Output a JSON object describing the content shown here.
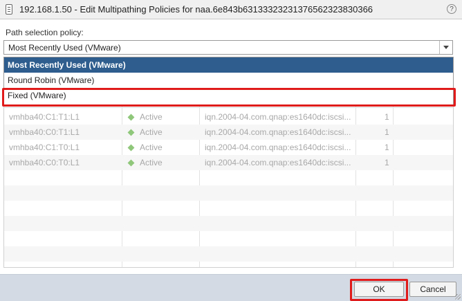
{
  "dialog": {
    "title": "192.168.1.50 - Edit Multipathing Policies for naa.6e843b6313332323137656232383036​6",
    "help_icon": "help-icon",
    "doc_icon": "server-icon"
  },
  "policy": {
    "label": "Path selection policy:",
    "selected": "Most Recently Used (VMware)",
    "options": [
      "Most Recently Used (VMware)",
      "Round Robin (VMware)",
      "Fixed (VMware)"
    ]
  },
  "paths": {
    "rows": [
      {
        "name": "vmhba40:C1:T1:L1",
        "status": "Active",
        "target": "iqn.2004-04.com.qnap:es1640dc:iscsi...",
        "lun": "1"
      },
      {
        "name": "vmhba40:C0:T1:L1",
        "status": "Active",
        "target": "iqn.2004-04.com.qnap:es1640dc:iscsi...",
        "lun": "1"
      },
      {
        "name": "vmhba40:C1:T0:L1",
        "status": "Active",
        "target": "iqn.2004-04.com.qnap:es1640dc:iscsi...",
        "lun": "1"
      },
      {
        "name": "vmhba40:C0:T0:L1",
        "status": "Active",
        "target": "iqn.2004-04.com.qnap:es1640dc:iscsi...",
        "lun": "1"
      }
    ]
  },
  "footer": {
    "ok_label": "OK",
    "cancel_label": "Cancel"
  },
  "colors": {
    "highlight": "#e01b1b",
    "selected_option": "#2e5d8e",
    "active_dot": "#8fc77a"
  }
}
